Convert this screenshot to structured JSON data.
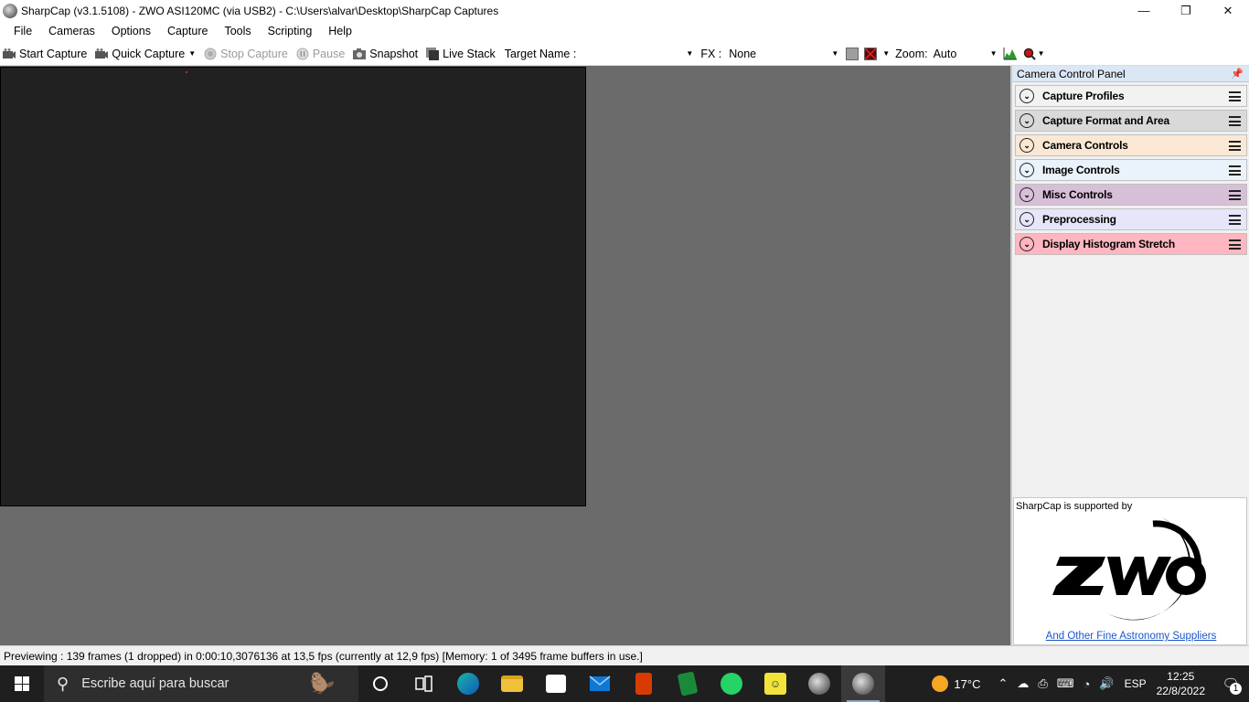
{
  "window": {
    "title": "SharpCap (v3.1.5108) - ZWO ASI120MC (via USB2) - C:\\Users\\alvar\\Desktop\\SharpCap Captures",
    "minimize": "—",
    "maximize": "❐",
    "close": "✕"
  },
  "menu": [
    "File",
    "Cameras",
    "Options",
    "Capture",
    "Tools",
    "Scripting",
    "Help"
  ],
  "toolbar": {
    "start_capture": "Start Capture",
    "quick_capture": "Quick Capture",
    "stop_capture": "Stop Capture",
    "pause": "Pause",
    "snapshot": "Snapshot",
    "live_stack": "Live Stack",
    "target_name_label": "Target Name :",
    "target_name_value": "",
    "fx_label": "FX :",
    "fx_value": "None",
    "zoom_label": "Zoom:",
    "zoom_value": "Auto"
  },
  "panel": {
    "title": "Camera Control Panel",
    "sections": [
      {
        "label": "Capture Profiles",
        "color": "#f2f2f2"
      },
      {
        "label": "Capture Format and Area",
        "color": "#d9d9d9"
      },
      {
        "label": "Camera Controls",
        "color": "#fbe8d4"
      },
      {
        "label": "Image Controls",
        "color": "#eaf2fb"
      },
      {
        "label": "Misc Controls",
        "color": "#d8bfd8"
      },
      {
        "label": "Preprocessing",
        "color": "#e6e6fa"
      },
      {
        "label": "Display Histogram Stretch",
        "color": "#ffb6c1"
      }
    ],
    "sponsor_text": "SharpCap is supported by",
    "sponsor_logo": "ZWO",
    "sponsor_link": "And Other Fine Astronomy Suppliers"
  },
  "status": "Previewing : 139 frames (1 dropped) in 0:00:10,3076136 at 13,5 fps  (currently at 12,9 fps) [Memory: 1 of 3495 frame buffers in use.]",
  "taskbar": {
    "search_placeholder": "Escribe aquí para buscar",
    "temperature": "17°C",
    "language": "ESP",
    "time": "12:25",
    "date": "22/8/2022",
    "notifications": "1"
  }
}
